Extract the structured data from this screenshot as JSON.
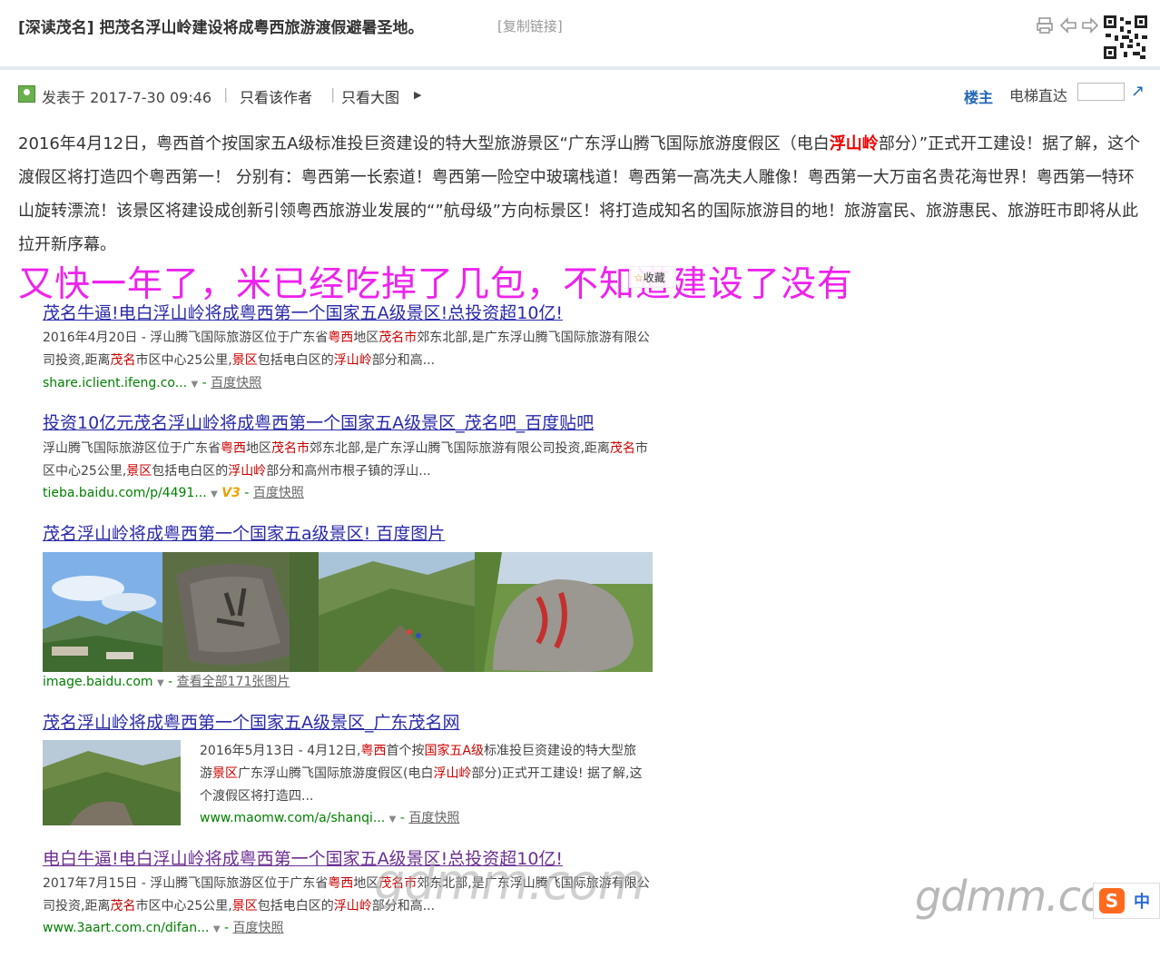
{
  "header": {
    "title": "[深读茂名] 把茂名浮山岭建设将成粤西旅游渡假避暑圣地。",
    "copy_link": "[复制链接]",
    "icons": [
      "printer-icon",
      "prev-thread-icon",
      "next-thread-icon",
      "qr-code-icon"
    ]
  },
  "post_bar": {
    "date": "发表于 2017-7-30 09:46",
    "only_author": "只看该作者",
    "only_big_image": "只看大图",
    "sep": "|",
    "floor_owner": "楼主",
    "floor_jump": "电梯直达"
  },
  "post": {
    "p1": "2016年4月12日，粤西首个按国家五A级标准投巨资建设的特大型旅游景区“广东浮山腾飞国际旅游度假区（电白",
    "p1_highlight": "浮山岭",
    "p2": "部分）”正式开工建设！据了解，这个渡假区将打造四个粤西第一！ 分别有：粤西第一长索道！粤西第一险空中玻璃栈道！粤西第一高冼夫人雕像！粤西第一大万亩名贵花海世界！粤西第一特环山旋转漂流！该景区将建设成创新引领粤西旅游业发展的“”航母级”方向标景区！将打造成知名的国际旅游目的地！旅游富民、旅游惠民、旅游旺市即将从此拉开新序幕。",
    "comment": "又快一年了，米已经吃掉了几包，不知道建设了没有",
    "favorite": "收藏"
  },
  "results": {
    "r1": {
      "title": "茂名牛逼!电白浮山岭将成粤西第一个国家五A级景区!总投资超10亿!",
      "snip_a": "2016年4月20日 - 浮山腾飞国际旅游区位于广东省",
      "snip_kw1": "粤西",
      "snip_b": "地区",
      "snip_kw2": "茂名市",
      "snip_c": "郊东北部,是广东浮山腾飞国际旅游有限公司投资,距离",
      "snip_kw3": "茂名",
      "snip_d": "市区中心25公里,",
      "snip_kw4": "景区",
      "snip_e": "包括电白区的",
      "snip_kw5": "浮山岭",
      "snip_f": "部分和高...",
      "url": "share.iclient.ifeng.co...",
      "cache": "百度快照"
    },
    "r2": {
      "title": "投资10亿元茂名浮山岭将成粤西第一个国家五A级景区_茂名吧_百度贴吧",
      "snip_a": "浮山腾飞国际旅游区位于广东省",
      "snip_kw1": "粤西",
      "snip_b": "地区",
      "snip_kw2": "茂名市",
      "snip_c": "郊东北部,是广东浮山腾飞国际旅游有限公司投资,距离",
      "snip_kw3": "茂名",
      "snip_d": "市区中心25公里,",
      "snip_kw4": "景区",
      "snip_e": "包括电白区的",
      "snip_kw5": "浮山岭",
      "snip_f": "部分和高州市根子镇的浮山...",
      "url": "tieba.baidu.com/p/4491...",
      "badge": "V3",
      "cache": "百度快照"
    },
    "r3": {
      "title": "茂名浮山岭将成粤西第一个国家五a级景区! 百度图片",
      "url": "image.baidu.com",
      "more": "查看全部171张图片"
    },
    "r4": {
      "title": "茂名浮山岭将成粤西第一个国家五A级景区_广东茂名网",
      "snip_a": "2016年5月13日 - 4月12日,",
      "snip_kw1": "粤西",
      "snip_b": "首个按",
      "snip_kw2": "国家五A级",
      "snip_c": "标准投巨资建设的特大型旅游",
      "snip_kw3": "景区",
      "snip_d": "广东浮山腾飞国际旅游度假区(电白",
      "snip_kw4": "浮山岭",
      "snip_e": "部分)正式开工建设! 据了解,这个渡假区将打造四...",
      "url": "www.maomw.com/a/shanqi...",
      "cache": "百度快照"
    },
    "r5": {
      "title": "电白牛逼!电白浮山岭将成粤西第一个国家五A级景区!总投资超10亿!",
      "snip_a": "2017年7月15日 - 浮山腾飞国际旅游区位于广东省",
      "snip_kw1": "粤西",
      "snip_b": "地区",
      "snip_kw2": "茂名市",
      "snip_c": "郊东北部,是广东浮山腾飞国际旅游有限公司投资,距离",
      "snip_kw3": "茂名",
      "snip_d": "市区中心25公里,",
      "snip_kw4": "景区",
      "snip_e": "包括电白区的",
      "snip_kw5": "浮山岭",
      "snip_f": "部分和高...",
      "url": "www.3aart.com.cn/difan...",
      "cache": "百度快照"
    }
  },
  "watermark": {
    "center": "gdmm.com",
    "corner": "gdmm.com"
  },
  "ime": {
    "logo": "S",
    "mode": "中"
  }
}
